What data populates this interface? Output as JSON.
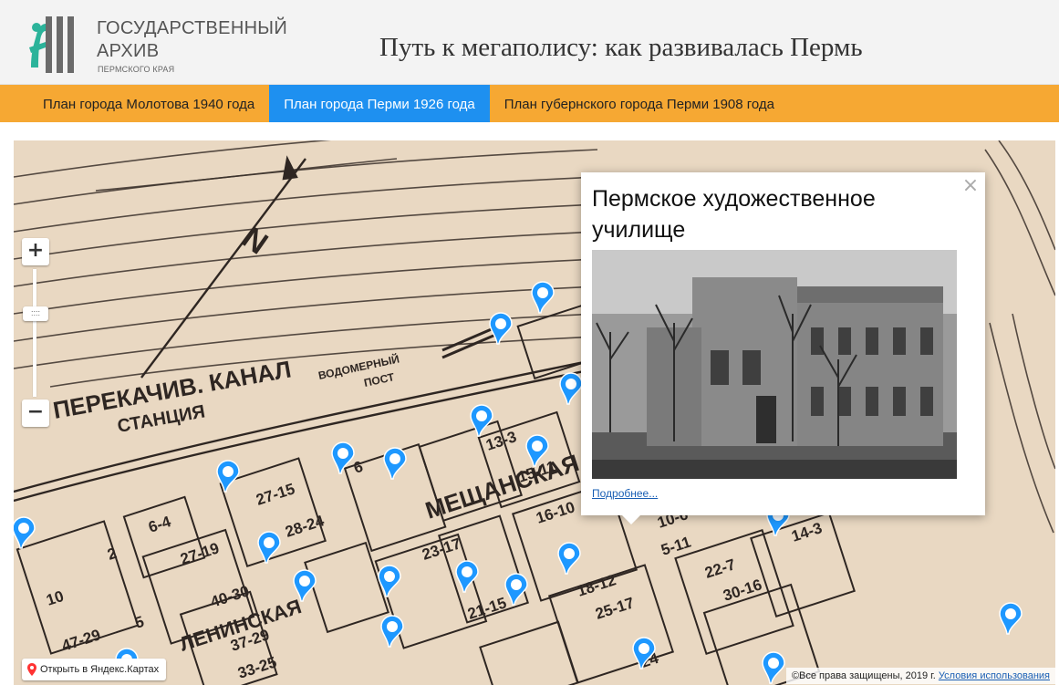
{
  "header": {
    "logo_line1": "ГОСУДАРСТВЕННЫЙ",
    "logo_line2": "АРХИВ",
    "logo_line3": "ПЕРМСКОГО КРАЯ",
    "title": "Путь к мегаполису: как развивалась Пермь"
  },
  "nav": {
    "tabs": [
      {
        "label": "План города Молотова 1940 года",
        "active": false
      },
      {
        "label": "План города Перми 1926 года",
        "active": true
      },
      {
        "label": "План губернского города Перми 1908 года",
        "active": false
      }
    ]
  },
  "map": {
    "zoom_in_label": "+",
    "zoom_out_label": "−",
    "zoom_handle_label": "::::",
    "map_text": {
      "station_1": "ПЕРЕКАЧИВ. КАНАЛ",
      "station_2": "СТАНЦИЯ",
      "waterworks_1": "ВОДОМЕРНЫЙ",
      "waterworks_2": "ПОСТ",
      "street": "МЕЩАНСКАЯ",
      "street_2": "ЛЕНИНСКАЯ",
      "north_letter": "N"
    },
    "block_numbers": [
      "6-4",
      "27-19",
      "40-30",
      "28-24",
      "47-29",
      "37-29",
      "33-25",
      "27-15",
      "23-17",
      "13-3",
      "15-11",
      "16-10",
      "18-12",
      "25-17",
      "21-15",
      "30-16",
      "22-7",
      "24",
      "10-6",
      "5-11",
      "14-3",
      "2",
      "10",
      "6",
      "5"
    ],
    "open_yandex_label": "Открыть в Яндекс.Картах",
    "copyright_text": "©Все права защищены, 2019 г.",
    "terms_label": "Условия использования",
    "marker_color": "#1e98ff",
    "popup": {
      "title": "Пермское художественное училище",
      "more_label": "Подробнее...",
      "close_label": "×"
    }
  },
  "colors": {
    "header_bg": "#f3f3f3",
    "nav_bg": "#f6a833",
    "nav_active_bg": "#1e90f0",
    "map_paper": "#e9d8c2",
    "logo_accent": "#2bb39a"
  }
}
